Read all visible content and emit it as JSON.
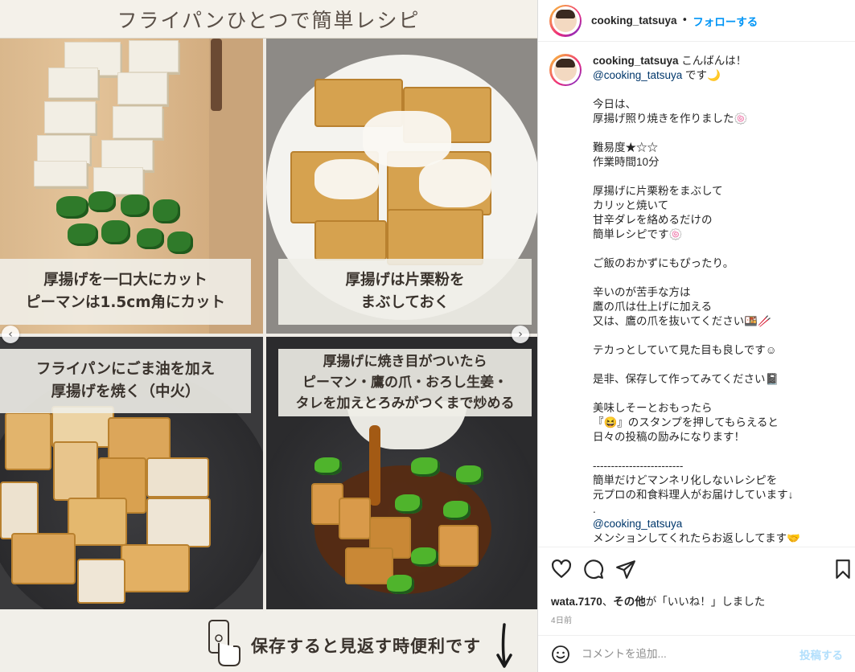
{
  "media": {
    "banner_title": "フライパンひとつで簡単レシピ",
    "step1": {
      "line1": "厚揚げを一口大にカット",
      "line2": "ピーマンは1.5cm角にカット"
    },
    "step2": {
      "line1": "厚揚げは片栗粉を",
      "line2": "まぶしておく"
    },
    "step3": {
      "line1": "フライパンにごま油を加え",
      "line2": "厚揚げを焼く（中火）"
    },
    "step4": {
      "line1": "厚揚げに焼き目がついたら",
      "line2": "ピーマン・鷹の爪・おろし生姜・",
      "line3": "タレを加えとろみがつくまで炒める"
    },
    "prev_glyph": "‹",
    "next_glyph": "›",
    "save_note": "保存すると見返す時便利です"
  },
  "header": {
    "username": "cooking_tatsuya",
    "separator": "•",
    "follow_label": "フォローする"
  },
  "caption": {
    "username": "cooking_tatsuya",
    "greeting": " こんばんは！",
    "mention": "@cooking_tatsuya",
    "after_mention": " です🌙",
    "body": "\n今日は、\n厚揚げ照り焼きを作りました🍥\n\n難易度★☆☆\n作業時間10分\n\n厚揚げに片栗粉をまぶして\nカリッと焼いて\n甘辛ダレを絡めるだけの\n簡単レシピです🍥\n\nご飯のおかずにもぴったり。\n\n辛いのが苦手な方は\n鷹の爪は仕上げに加える\n又は、鷹の爪を抜いてください🍱🥢\n\nテカっとしていて見た目も良しです☺\n\n是非、保存して作ってみてください📓\n\n美味しそーとおもったら\n『😆』のスタンプを押してもらえると\n日々の投稿の励みになります！\n\n-------------------------\n簡単だけどマンネリ化しないレシピを\n元プロの和食料理人がお届けしています↓\n.",
    "mention2": "@cooking_tatsuya",
    "closing": "メンションしてくれたらお返ししてます🤝"
  },
  "actions": {
    "likes_user": "wata.7170",
    "likes_mid": "、",
    "likes_others": "その他",
    "likes_tail": "が「いいね！」しました",
    "date": "4日前"
  },
  "comment": {
    "placeholder": "コメントを追加...",
    "post_label": "投稿する"
  }
}
